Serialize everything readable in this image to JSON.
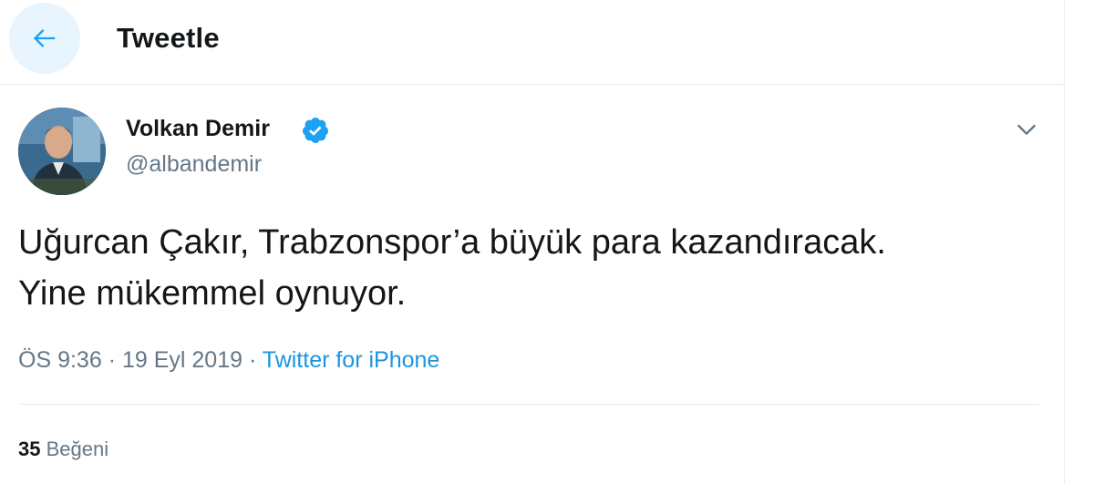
{
  "header": {
    "title": "Tweetle",
    "back_icon": "arrow-left-icon",
    "accent": "#1da1f2"
  },
  "tweet": {
    "author_name": "Volkan Demir",
    "verified": true,
    "handle": "@albandemir",
    "text": "Uğurcan Çakır, Trabzonspor’a büyük para kazandıracak.\nYine mükemmel oynuyor.",
    "time": "ÖS 9:36",
    "date": "19 Eyl 2019",
    "separator": "·",
    "source": "Twitter for iPhone",
    "likes_count": "35",
    "likes_label": "Beğeni"
  },
  "colors": {
    "text_primary": "#14171a",
    "text_secondary": "#657786",
    "link": "#1b95e0",
    "back_button_bg": "#e8f5fe",
    "divider": "#e6ecf0"
  }
}
